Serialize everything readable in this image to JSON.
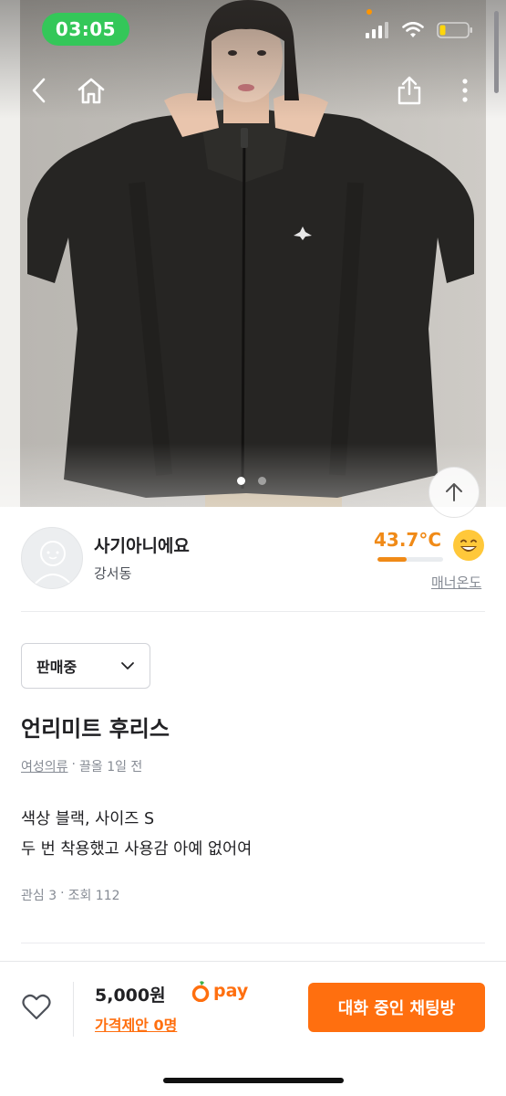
{
  "status_bar": {
    "time": "03:05"
  },
  "hero": {
    "image_alt": "Black fleece jacket product photo",
    "dots_count": 2,
    "active_dot": 0
  },
  "seller": {
    "name": "사기아니에요",
    "location": "강서동",
    "temperature": "43.7°C",
    "temperature_value": 43.7,
    "temperature_bar_fraction": 0.44,
    "manner_label": "매너온도"
  },
  "listing": {
    "status": "판매중",
    "title": "언리미트 후리스",
    "category": "여성의류",
    "meta_sep": "·",
    "posted": "끌올 1일 전",
    "description_line1": "색상 블랙, 사이즈 S",
    "description_line2": "두 번 착용했고 사용감 아예 없어여",
    "interest": "관심 3",
    "views": "조회 112"
  },
  "bottom_bar": {
    "price": "5,000원",
    "pay_label": "pay",
    "offer": "가격제안 0명",
    "chat_button": "대화 중인 채팅방"
  },
  "colors": {
    "accent": "#ff6f0f",
    "temperature": "#f08a17",
    "status_time_pill": "#34c759"
  }
}
